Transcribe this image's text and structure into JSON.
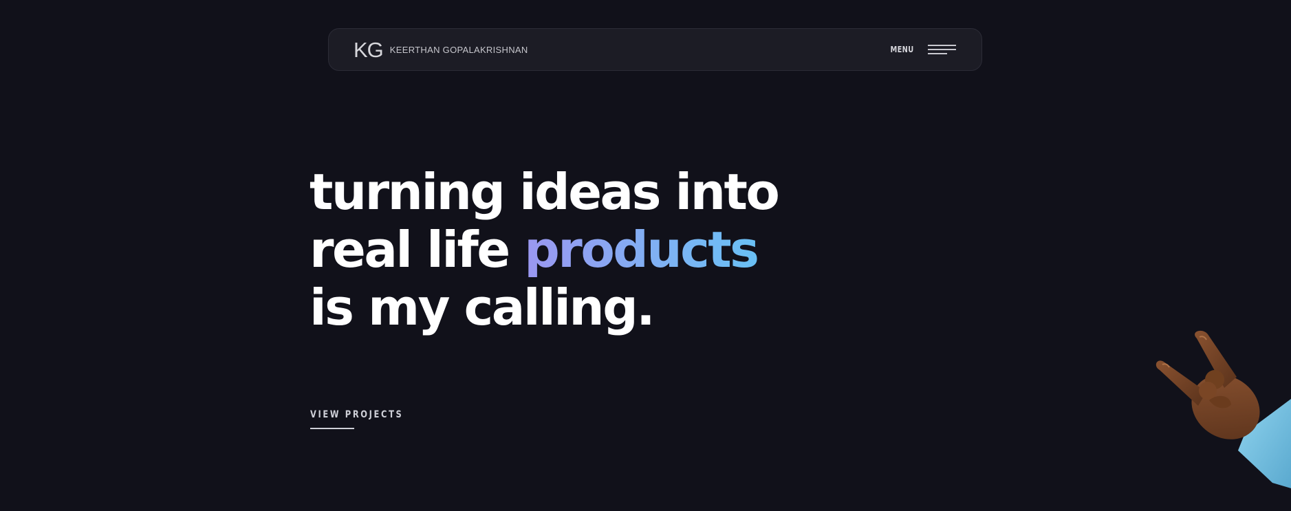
{
  "header": {
    "logo_text": "KG",
    "brand_name": "KEERTHAN GOPALAKRISHNAN",
    "menu_label": "MENU"
  },
  "hero": {
    "line1": "turning ideas into",
    "line2_plain": "real life ",
    "line2_highlight": "products",
    "line3": "is my calling."
  },
  "cta": {
    "view_projects_label": "VIEW PROJECTS"
  },
  "colors": {
    "background": "#11111a",
    "navbar_background": "#1c1c25",
    "gradient_start": "#9b97f1",
    "gradient_end": "#69c0f4",
    "heading": "#ffffff"
  },
  "icons": {
    "menu": "hamburger-icon",
    "decoration": "rock-on-hand-illustration"
  }
}
